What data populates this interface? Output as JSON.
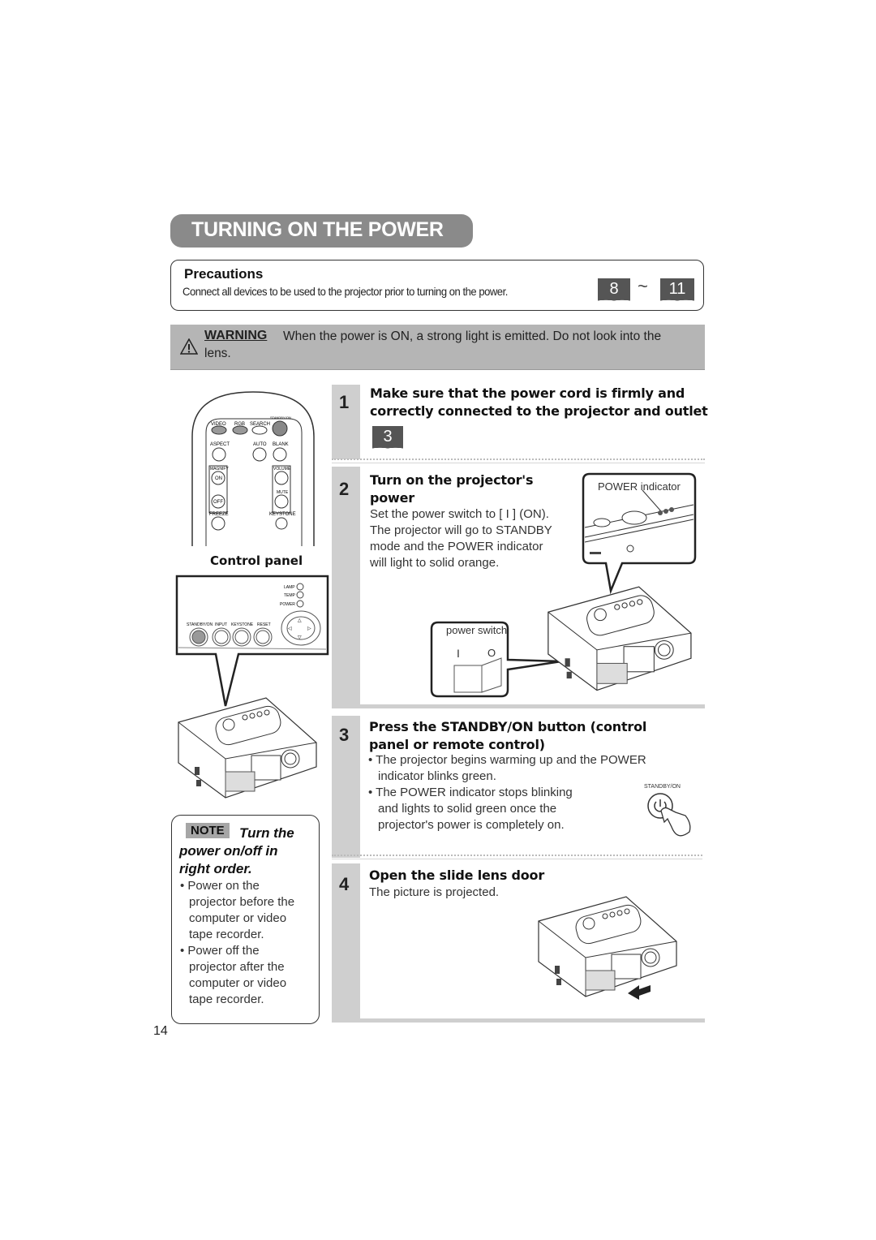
{
  "title": "TURNING ON THE POWER",
  "precautions": {
    "heading": "Precautions",
    "text": "Connect all devices to be used to the projector prior to turning on the power.",
    "page_ref_start": "8",
    "page_ref_separator": "~",
    "page_ref_end": "11"
  },
  "warning": {
    "label": "WARNING",
    "text": "When the power is ON, a strong light is emitted. Do not look into the",
    "text_cont": "lens."
  },
  "remote": {
    "buttons": [
      "VIDEO",
      "RGB",
      "SEARCH",
      "STANDBY/ON",
      "ASPECT",
      "AUTO",
      "BLANK",
      "MAGNIFY",
      "ON",
      "OFF",
      "VOLUME",
      "MUTE",
      "FREEZE",
      "KEYSTONE"
    ]
  },
  "control_panel": {
    "label": "Control panel",
    "indicators": [
      "LAMP",
      "TEMP",
      "POWER"
    ],
    "buttons": [
      "STANDBY/ON",
      "INPUT",
      "KEYSTONE",
      "RESET"
    ]
  },
  "note": {
    "badge": "NOTE",
    "title_line1": "Turn the",
    "title_line2": "power on/off in",
    "title_line3": "right order.",
    "items": [
      {
        "lines": [
          "Power on the",
          "projector before the",
          "computer or video",
          "tape recorder."
        ]
      },
      {
        "lines": [
          "Power off the",
          "projector after the",
          "computer or video",
          "tape recorder."
        ]
      }
    ]
  },
  "steps": [
    {
      "number": "1",
      "heading_line1": "Make sure that the power cord is firmly and",
      "heading_line2": "correctly connected to the projector and outlet",
      "page_ref": "3"
    },
    {
      "number": "2",
      "heading_line1": "Turn on the projector's",
      "heading_line2": "power",
      "body": [
        "Set the power switch to [ I ] (ON).",
        "The projector will go to STANDBY",
        "mode and the POWER indicator",
        "will light to solid orange."
      ],
      "callout_power_indicator": "POWER indicator",
      "callout_power_switch": "power switch",
      "switch_on_symbol": "I",
      "switch_off_symbol": "O"
    },
    {
      "number": "3",
      "heading_line1": "Press the STANDBY/ON button (control",
      "heading_line2": "panel or remote control)",
      "bullets": [
        {
          "lines": [
            "The projector begins warming up and the POWER",
            "indicator blinks green."
          ]
        },
        {
          "lines": [
            "The POWER indicator stops blinking",
            "and lights to solid green once the",
            "projector's power is completely on."
          ]
        }
      ],
      "button_label": "STANDBY/ON"
    },
    {
      "number": "4",
      "heading": "Open the slide lens door",
      "body": "The picture is projected."
    }
  ],
  "page_number": "14"
}
